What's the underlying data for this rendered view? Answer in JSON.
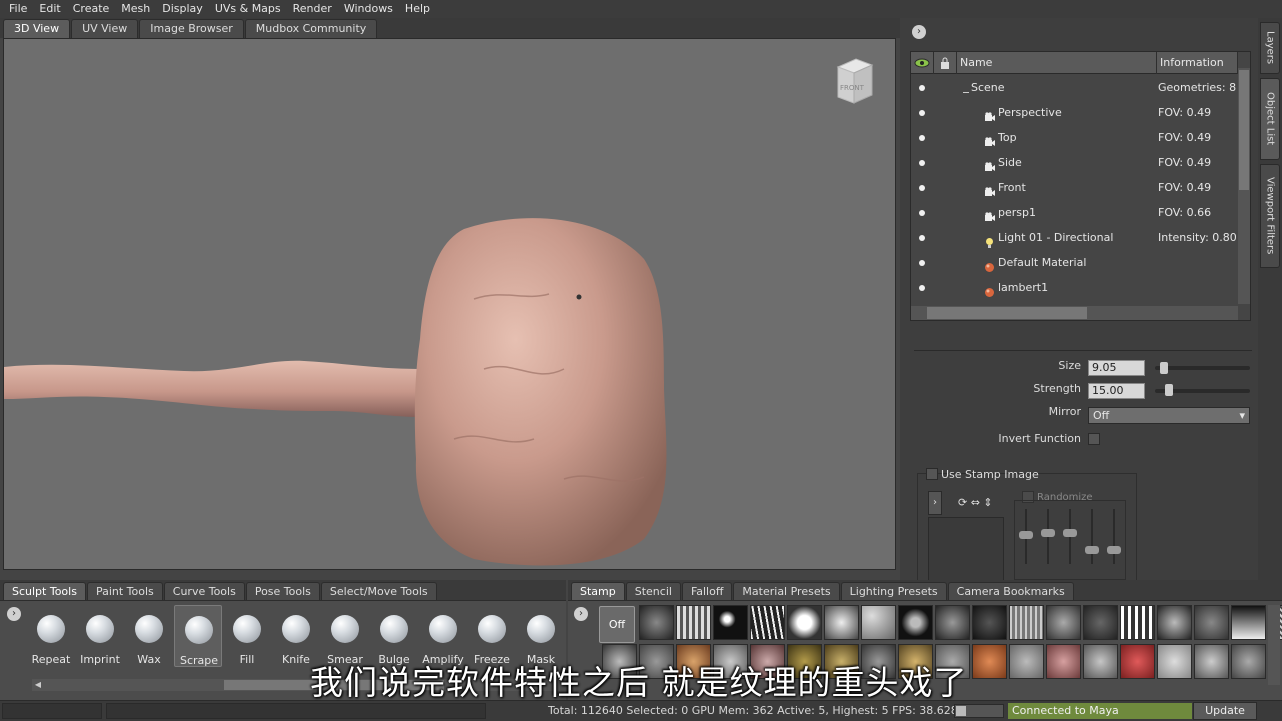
{
  "menubar": {
    "items": [
      "File",
      "Edit",
      "Create",
      "Mesh",
      "Display",
      "UVs & Maps",
      "Render",
      "Windows",
      "Help"
    ]
  },
  "view_tabs": [
    {
      "label": "3D View",
      "active": true
    },
    {
      "label": "UV View",
      "active": false
    },
    {
      "label": "Image Browser",
      "active": false
    },
    {
      "label": "Mudbox Community",
      "active": false
    }
  ],
  "viewcube": {
    "face_label": "FRONT"
  },
  "side_tabs": [
    "Layers",
    "Object List",
    "Viewport Filters"
  ],
  "object_list": {
    "headers": {
      "name": "Name",
      "info": "Information"
    },
    "rows": [
      {
        "name": "Scene",
        "info": "Geometries: 8",
        "icon": "minus-icon"
      },
      {
        "name": "Perspective",
        "info": "FOV: 0.49",
        "icon": "camera-icon"
      },
      {
        "name": "Top",
        "info": "FOV: 0.49",
        "icon": "camera-icon"
      },
      {
        "name": "Side",
        "info": "FOV: 0.49",
        "icon": "camera-icon"
      },
      {
        "name": "Front",
        "info": "FOV: 0.49",
        "icon": "camera-icon"
      },
      {
        "name": "persp1",
        "info": "FOV: 0.66",
        "icon": "camera-icon"
      },
      {
        "name": "Light 01 - Directional",
        "info": "Intensity: 0.80",
        "icon": "light-bulb-icon"
      },
      {
        "name": "Default Material",
        "info": "",
        "icon": "material-sphere-icon"
      },
      {
        "name": "lambert1",
        "info": "",
        "icon": "material-sphere-icon"
      }
    ]
  },
  "properties": {
    "size_label": "Size",
    "size_value": "9.05",
    "size_slider_fraction": 0.09,
    "strength_label": "Strength",
    "strength_value": "15.00",
    "strength_slider_fraction": 0.15,
    "mirror_label": "Mirror",
    "mirror_value": "Off",
    "invert_label": "Invert Function",
    "use_stamp_label": "Use Stamp Image",
    "randomize_label": "Randomize"
  },
  "shelf_tabs": [
    {
      "label": "Sculpt Tools",
      "active": true
    },
    {
      "label": "Paint Tools",
      "active": false
    },
    {
      "label": "Curve Tools",
      "active": false
    },
    {
      "label": "Pose Tools",
      "active": false
    },
    {
      "label": "Select/Move Tools",
      "active": false
    }
  ],
  "sculpt_tools": [
    {
      "label": "Repeat",
      "selected": false
    },
    {
      "label": "Imprint",
      "selected": false
    },
    {
      "label": "Wax",
      "selected": false
    },
    {
      "label": "Scrape",
      "selected": true
    },
    {
      "label": "Fill",
      "selected": false
    },
    {
      "label": "Knife",
      "selected": false
    },
    {
      "label": "Smear",
      "selected": false
    },
    {
      "label": "Bulge",
      "selected": false
    },
    {
      "label": "Amplify",
      "selected": false
    },
    {
      "label": "Freeze",
      "selected": false
    },
    {
      "label": "Mask",
      "selected": false
    }
  ],
  "stamp_tabs": [
    {
      "label": "Stamp",
      "active": true
    },
    {
      "label": "Stencil",
      "active": false
    },
    {
      "label": "Falloff",
      "active": false
    },
    {
      "label": "Material Presets",
      "active": false
    },
    {
      "label": "Lighting Presets",
      "active": false
    },
    {
      "label": "Camera Bookmarks",
      "active": false
    }
  ],
  "stamp_off_label": "Off",
  "status": {
    "text": "Total: 112640  Selected: 0 GPU Mem: 362  Active: 5, Highest: 5  FPS: 38.6287",
    "maya": "Connected to Maya",
    "update": "Update"
  },
  "subtitle": "我们说完软件特性之后 就是纹理的重头戏了",
  "colors": {
    "model_skin": "#c99a8c",
    "viewport_bg": "#6e6e6e",
    "maya_connected": "#6f8a3d"
  }
}
